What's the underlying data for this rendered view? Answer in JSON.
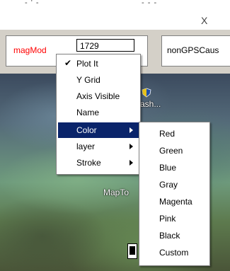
{
  "window": {
    "top_fragments": [
      "- ' -",
      "- - -"
    ],
    "close_label": "X"
  },
  "fields": {
    "mag_label": "magMod",
    "mag_value": "1729",
    "cause_label": "nonGPSCaus"
  },
  "map": {
    "label_flash": "ash...",
    "label_mapto": "MapTo"
  },
  "context_menu": {
    "items": [
      {
        "label": "Plot It",
        "checked": true
      },
      {
        "label": "Y Grid",
        "checked": false
      },
      {
        "label": "Axis Visible",
        "checked": false
      },
      {
        "label": "Name",
        "checked": false
      },
      {
        "label": "Color",
        "checked": false,
        "submenu": true
      },
      {
        "label": "layer",
        "checked": false,
        "submenu": true
      },
      {
        "label": "Stroke",
        "checked": false,
        "submenu": true
      }
    ],
    "check_glyph": "✔"
  },
  "color_submenu": {
    "items": [
      "Red",
      "Green",
      "Blue",
      "Gray",
      "Magenta",
      "Pink",
      "Black",
      "Custom"
    ]
  },
  "colors": {
    "highlight": "#0a246a",
    "label_red": "#ff0000",
    "panel_gray": "#d4d0c8"
  }
}
